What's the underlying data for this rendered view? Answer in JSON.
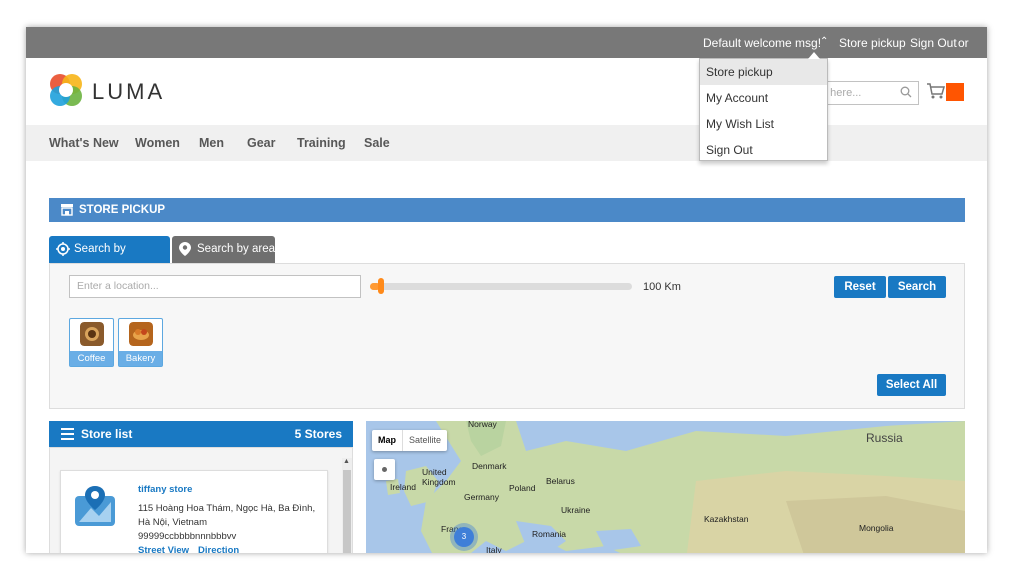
{
  "topbar": {
    "welcome": "Default welcome msg!",
    "links": [
      "Store pickup",
      "Sign Out",
      "or"
    ]
  },
  "dropdown": {
    "items": [
      "Store pickup",
      "My Account",
      "My Wish List",
      "Sign Out"
    ]
  },
  "header": {
    "logo_text": "LUMA",
    "search_placeholder": "e here...",
    "accent_color": "#ff5501"
  },
  "nav": {
    "items": [
      "What's New",
      "Women",
      "Men",
      "Gear",
      "Training",
      "Sale"
    ]
  },
  "store_pickup": {
    "title": "STORE PICKUP",
    "tabs": [
      "Search by distance",
      "Search by area"
    ],
    "location_placeholder": "Enter a location...",
    "distance": "100 Km",
    "reset_label": "Reset",
    "search_label": "Search",
    "select_all_label": "Select All",
    "categories": [
      "Coffee",
      "Bakery"
    ]
  },
  "store_list": {
    "title": "Store list",
    "count": "5 Stores",
    "stores": [
      {
        "name": "tiffany store",
        "address_line1": "115 Hoàng Hoa Thám, Ngọc Hà, Ba Đình,",
        "address_line2": "Hà Nội, Vietnam",
        "phone": "99999ccbbbbnnnbbbvv",
        "link1": "Street View",
        "link2": "Direction"
      }
    ]
  },
  "map": {
    "type_map": "Map",
    "type_satellite": "Satellite",
    "cluster_count": "3",
    "labels": [
      "Norway",
      "Denmark",
      "United Kingdom",
      "Ireland",
      "Germany",
      "Poland",
      "Belarus",
      "Ukraine",
      "France",
      "Romania",
      "Italy",
      "Russia",
      "Kazakhstan",
      "Mongolia"
    ]
  }
}
